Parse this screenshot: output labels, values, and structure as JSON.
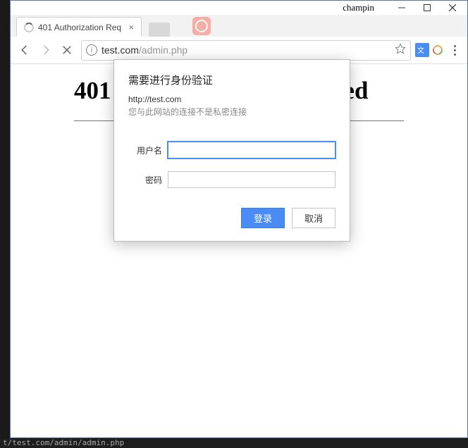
{
  "watermark": "champin",
  "tab": {
    "title": "401 Authorization Req"
  },
  "url": {
    "host": "test.com",
    "path": "/admin.php"
  },
  "page": {
    "heading": "401 Authorization Required"
  },
  "dialog": {
    "title": "需要进行身份验证",
    "host": "http://test.com",
    "note": "您与此网站的连接不是私密连接",
    "username_label": "用户名",
    "password_label": "密码",
    "login": "登录",
    "cancel": "取消"
  },
  "bottom_strip": "t/test.com/admin/admin.php"
}
